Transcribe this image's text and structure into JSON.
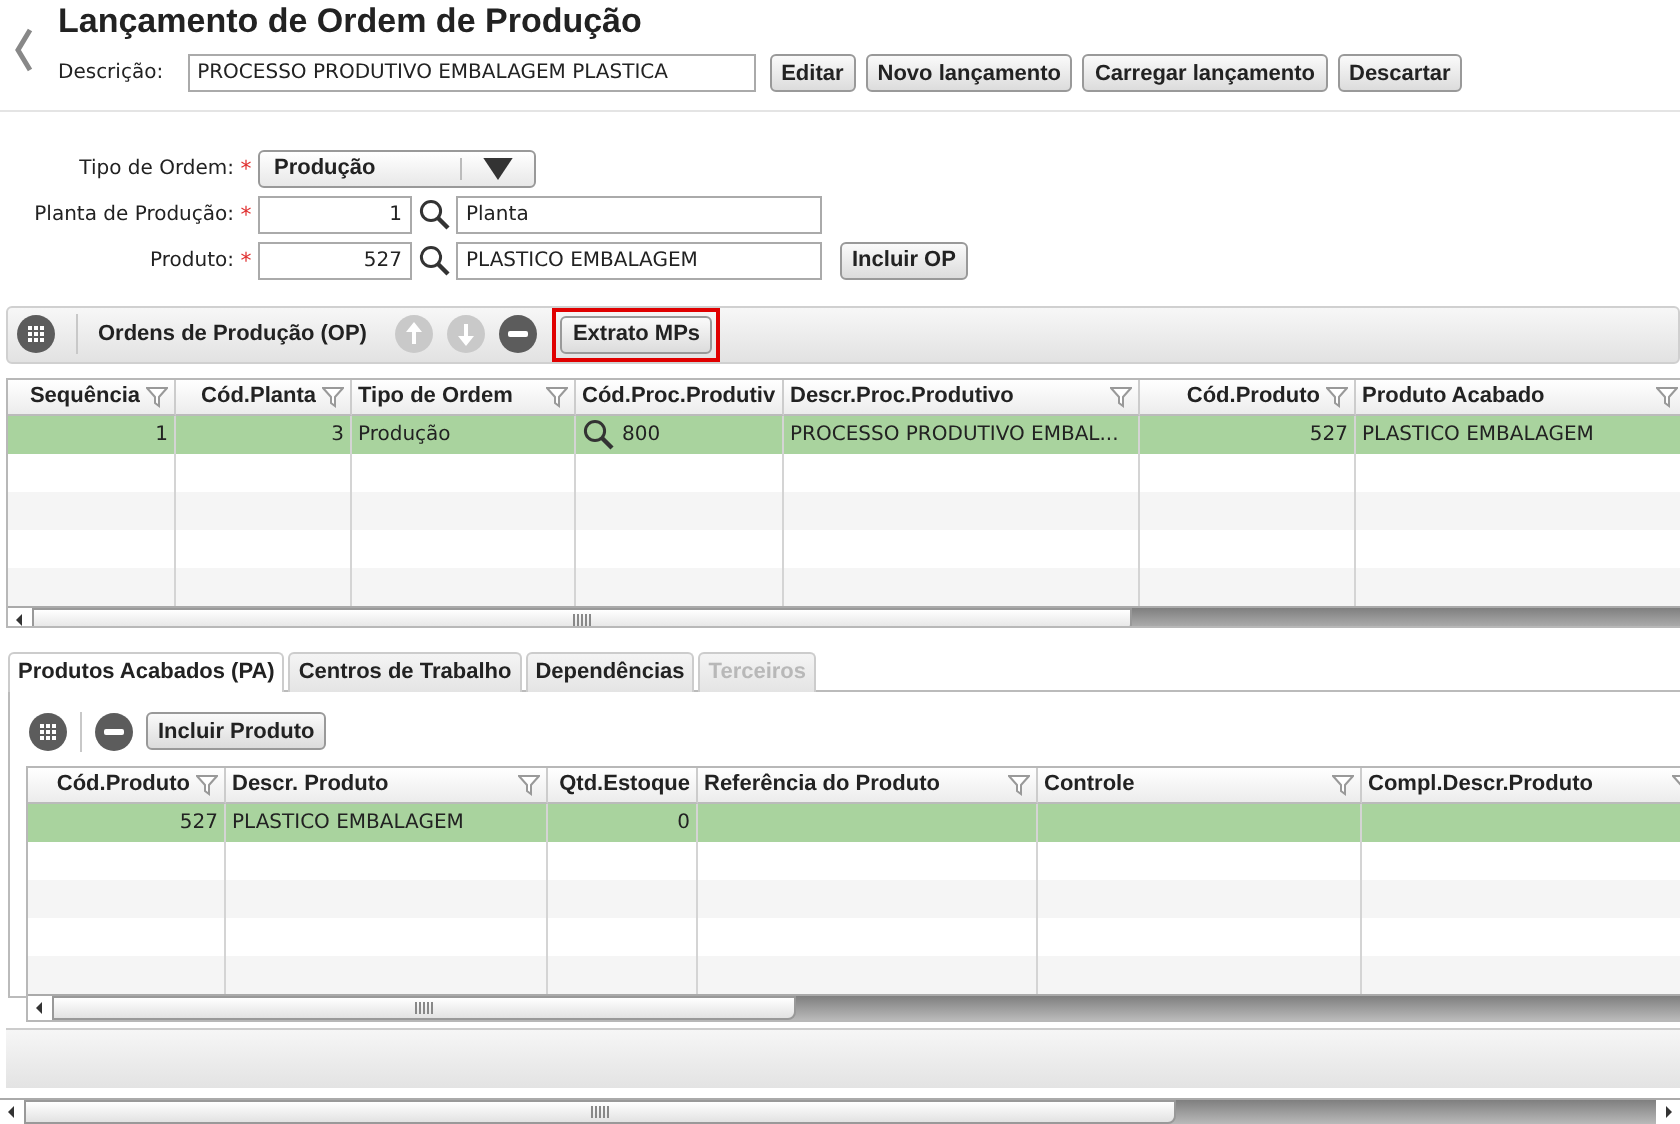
{
  "title": "Lançamento de Ordem de Produção",
  "description": {
    "label": "Descrição:",
    "value": "PROCESSO PRODUTIVO EMBALAGEM PLASTICA"
  },
  "header_buttons": [
    "Editar",
    "Novo lançamento",
    "Carregar lançamento",
    "Descartar"
  ],
  "form": [
    {
      "kind": "select",
      "label": "Tipo de Ordem:",
      "required_mark": "*",
      "value": "Produção"
    },
    {
      "kind": "lookup",
      "label": "Planta de Produção:",
      "required_mark": "*",
      "code": "1",
      "name": "Planta"
    },
    {
      "kind": "lookup",
      "label": "Produto:",
      "required_mark": "*",
      "code": "527",
      "name": "PLASTICO EMBALAGEM",
      "button": "Incluir OP"
    }
  ],
  "orders": {
    "title": "Ordens de Produção (OP)",
    "tools": [
      {
        "kind": "up",
        "disabled": true
      },
      {
        "kind": "down",
        "disabled": true
      },
      {
        "kind": "remove",
        "disabled": false
      }
    ],
    "button": {
      "label": "Extrato MPs",
      "highlighted": true
    },
    "columns": [
      {
        "label": "Sequência",
        "filter": true,
        "kind": "number"
      },
      {
        "label": "Cód.Planta",
        "filter": true,
        "kind": "number"
      },
      {
        "label": "Tipo de Ordem",
        "filter": true,
        "kind": "text"
      },
      {
        "label": "Cód.Proc.Produtiv",
        "filter": false,
        "kind": "lookup"
      },
      {
        "label": "Descr.Proc.Produtivo",
        "filter": true,
        "kind": "text"
      },
      {
        "label": "Cód.Produto",
        "filter": true,
        "kind": "number"
      },
      {
        "label": "Produto Acabado",
        "filter": true,
        "kind": "text"
      }
    ],
    "rows": [
      {
        "selected": true,
        "cells": [
          "1",
          "3",
          "Produção",
          "800",
          "PROCESSO PRODUTIVO EMBAL...",
          "527",
          "PLASTICO EMBALAGEM"
        ]
      }
    ]
  },
  "tabs": [
    {
      "label": "Produtos Acabados (PA)",
      "selected": true,
      "disabled": false
    },
    {
      "label": "Centros de Trabalho",
      "selected": false,
      "disabled": false
    },
    {
      "label": "Dependências",
      "selected": false,
      "disabled": false
    },
    {
      "label": "Terceiros",
      "selected": false,
      "disabled": true
    }
  ],
  "products": {
    "tools": [
      {
        "kind": "remove",
        "disabled": false
      }
    ],
    "button": "Incluir Produto",
    "columns": [
      {
        "label": "Cód.Produto",
        "filter": true,
        "kind": "number"
      },
      {
        "label": "Descr. Produto",
        "filter": true,
        "kind": "text"
      },
      {
        "label": "Qtd.Estoque",
        "filter": false,
        "kind": "number"
      },
      {
        "label": "Referência do Produto",
        "filter": true,
        "kind": "text"
      },
      {
        "label": "Controle",
        "filter": true,
        "kind": "text"
      },
      {
        "label": "Compl.Descr.Produto",
        "filter": true,
        "kind": "text"
      }
    ],
    "rows": [
      {
        "selected": true,
        "cells": [
          "527",
          "PLASTICO EMBALAGEM",
          "0",
          "",
          "",
          ""
        ]
      }
    ]
  }
}
